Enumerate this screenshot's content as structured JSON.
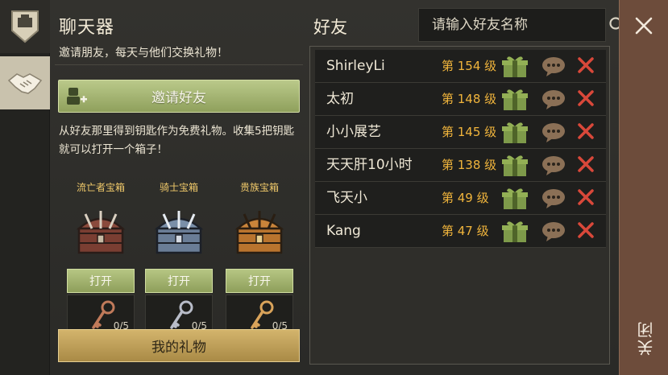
{
  "header": {
    "title": "聊天器",
    "subtitle": "邀请朋友，每天与他们交换礼物！"
  },
  "tabs": [
    {
      "icon": "guild-emblem-icon"
    },
    {
      "icon": "handshake-icon",
      "active": true
    }
  ],
  "invite": {
    "label": "邀请好友",
    "icon": "add-user-icon"
  },
  "description": "从好友那里得到钥匙作为免费礼物。收集5把钥匙就可以打开一个箱子！",
  "chests": [
    {
      "name": "流亡者宝箱",
      "open_label": "打开",
      "keys": "0/5",
      "color": "#8a4a3c",
      "key_color": "#c07a5a"
    },
    {
      "name": "骑士宝箱",
      "open_label": "打开",
      "keys": "0/5",
      "color": "#7a8fa8",
      "key_color": "#b8bcc8"
    },
    {
      "name": "贵族宝箱",
      "open_label": "打开",
      "keys": "0/5",
      "color": "#c9843a",
      "key_color": "#d9a35a"
    }
  ],
  "my_gifts_label": "我的礼物",
  "friends": {
    "title": "好友",
    "search_placeholder": "请输入好友名称",
    "list": [
      {
        "name": "ShirleyLi",
        "level": "第 154 级"
      },
      {
        "name": "太初",
        "level": "第 148 级"
      },
      {
        "name": "小小展艺",
        "level": "第 145 级"
      },
      {
        "name": "天天肝10小时",
        "level": "第 138 级"
      },
      {
        "name": "飞天小",
        "level": "第 49 级"
      },
      {
        "name": "Kang",
        "level": "第 47 级"
      }
    ]
  },
  "close": {
    "label": "关闭"
  },
  "colors": {
    "accent_green": "#8fa05c",
    "accent_gold": "#c9a85c",
    "level_orange": "#f0b43c",
    "delete_red": "#d9483a",
    "close_panel": "#6d4c3b"
  }
}
